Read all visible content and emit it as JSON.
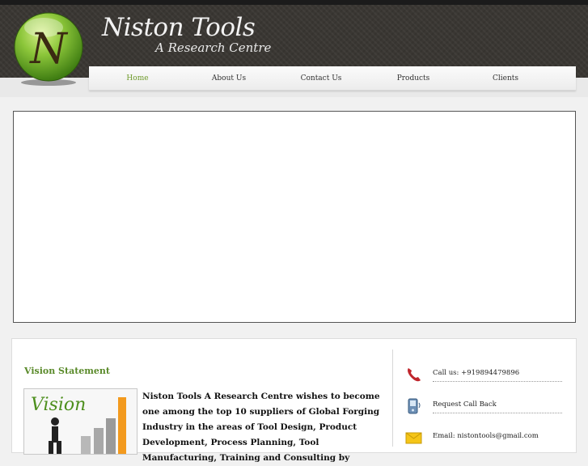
{
  "brand": {
    "logo_letter": "N",
    "title": "Niston Tools",
    "subtitle": "A Research Centre"
  },
  "nav": {
    "items": [
      "Home",
      "About Us",
      "Contact Us",
      "Products",
      "Clients"
    ],
    "active": "Home"
  },
  "vision": {
    "heading": "Vision Statement",
    "image_label": "Vision",
    "text": "Niston Tools A Research Centre wishes to become one among the top 10 suppliers of Global Forging Industry in the areas of Tool Design, Product Development, Process Planning, Tool Manufacturing, Training and Consulting by"
  },
  "contacts": {
    "call": "Call us: +919894479896",
    "callback": "Request Call Back",
    "email": "Email: nistontools@gmail.com"
  },
  "colors": {
    "header_bg": "#3a3733",
    "accent_green": "#6f9b2b",
    "heading_green": "#5a8a2a"
  },
  "icons": [
    "phone-icon",
    "mobile-phone-icon",
    "envelope-icon"
  ]
}
